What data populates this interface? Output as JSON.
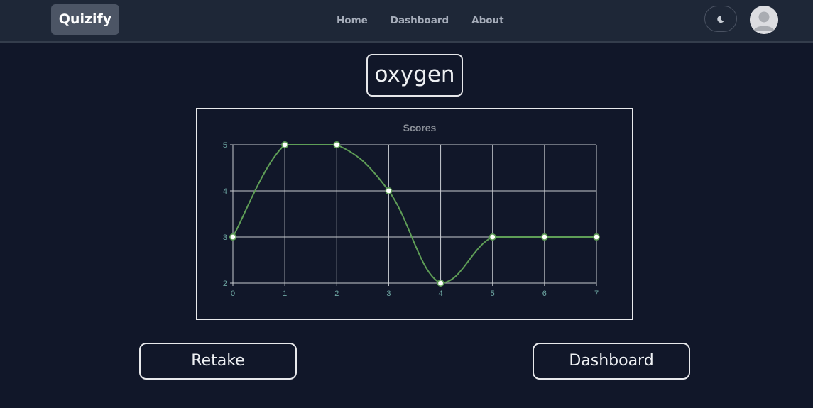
{
  "header": {
    "brand": "Quizify",
    "nav": [
      {
        "label": "Home"
      },
      {
        "label": "Dashboard"
      },
      {
        "label": "About"
      }
    ],
    "theme_icon": "moon-icon",
    "avatar_icon": "user-avatar-icon"
  },
  "quiz": {
    "title": "oxygen"
  },
  "actions": {
    "retake_label": "Retake",
    "dashboard_label": "Dashboard"
  },
  "colors": {
    "background": "#111729",
    "navbar": "#1e2737",
    "line": "#5f9e57",
    "tick_text": "#6fa8a4",
    "title_text": "#8a8f98"
  },
  "chart_data": {
    "type": "line",
    "title": "Scores",
    "xlabel": "",
    "ylabel": "",
    "x": [
      0,
      1,
      2,
      3,
      4,
      5,
      6,
      7
    ],
    "series": [
      {
        "values": [
          3,
          5,
          5,
          4,
          2,
          3,
          3,
          3
        ]
      }
    ],
    "xlim": [
      0,
      7
    ],
    "ylim": [
      2,
      5
    ],
    "x_ticks": [
      "0",
      "1",
      "2",
      "3",
      "4",
      "5",
      "6",
      "7"
    ],
    "y_ticks": [
      "2",
      "3",
      "4",
      "5"
    ],
    "grid": true,
    "smooth": true,
    "legend": "none"
  }
}
